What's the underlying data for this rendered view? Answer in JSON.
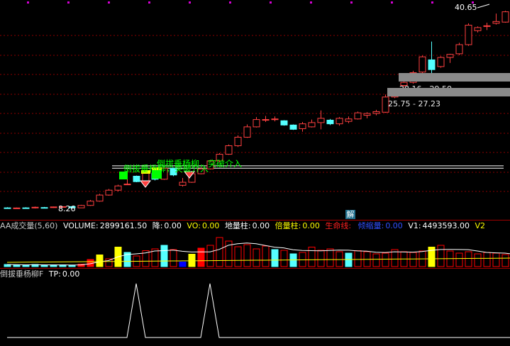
{
  "chart_data": [
    {
      "type": "candlestick",
      "panel": "price",
      "max_label": "40.65",
      "min_label": "8.26",
      "bands": [
        {
          "label": "28.16 - 29.50",
          "low": 28.16,
          "high": 29.5
        },
        {
          "label": "25.75 - 27.23",
          "low": 25.75,
          "high": 27.23
        }
      ],
      "signals": [
        {
          "text": "倒拔垂杨柳，突破介入",
          "color": "#00ff00"
        },
        {
          "text": "倒拔垂杨柳，突破介入",
          "color": "#00ff00"
        }
      ],
      "resistance_lines": [
        15.2,
        14.8
      ],
      "candles": [
        {
          "o": 8.3,
          "h": 8.4,
          "l": 8.2,
          "c": 8.3,
          "up": false
        },
        {
          "o": 8.25,
          "h": 8.35,
          "l": 8.15,
          "c": 8.28,
          "up": true
        },
        {
          "o": 8.3,
          "h": 8.4,
          "l": 8.2,
          "c": 8.3,
          "up": false
        },
        {
          "o": 8.3,
          "h": 8.5,
          "l": 8.2,
          "c": 8.4,
          "up": true
        },
        {
          "o": 8.35,
          "h": 8.45,
          "l": 8.25,
          "c": 8.35,
          "up": false
        },
        {
          "o": 8.4,
          "h": 8.5,
          "l": 8.3,
          "c": 8.45,
          "up": true
        },
        {
          "o": 8.45,
          "h": 8.55,
          "l": 8.4,
          "c": 8.5,
          "up": true
        },
        {
          "o": 8.5,
          "h": 8.6,
          "l": 8.2,
          "c": 8.3,
          "up": false
        },
        {
          "o": 8.3,
          "h": 8.8,
          "l": 8.26,
          "c": 8.7,
          "up": true
        },
        {
          "o": 8.7,
          "h": 9.6,
          "l": 8.6,
          "c": 9.4,
          "up": true
        },
        {
          "o": 9.4,
          "h": 10.6,
          "l": 9.3,
          "c": 10.4,
          "up": true
        },
        {
          "o": 10.4,
          "h": 11.4,
          "l": 10.3,
          "c": 11.2,
          "up": true
        },
        {
          "o": 11.2,
          "h": 12.1,
          "l": 11.0,
          "c": 11.9,
          "up": true
        },
        {
          "o": 12.2,
          "h": 14.8,
          "l": 12.1,
          "c": 12.2,
          "up": true
        },
        {
          "o": 13.5,
          "h": 13.6,
          "l": 12.5,
          "c": 12.6,
          "up": false
        },
        {
          "o": 12.6,
          "h": 14.5,
          "l": 12.3,
          "c": 14.0,
          "up": true
        },
        {
          "o": 14.0,
          "h": 14.2,
          "l": 12.8,
          "c": 13.0,
          "up": false
        },
        {
          "o": 13.0,
          "h": 14.9,
          "l": 12.9,
          "c": 14.8,
          "up": true
        },
        {
          "o": 14.8,
          "h": 14.9,
          "l": 13.5,
          "c": 13.7,
          "up": false
        },
        {
          "o": 12.5,
          "h": 13.2,
          "l": 11.8,
          "c": 12.0,
          "up": true
        },
        {
          "o": 12.5,
          "h": 14.1,
          "l": 12.4,
          "c": 13.9,
          "up": true
        },
        {
          "o": 13.9,
          "h": 15.0,
          "l": 13.8,
          "c": 14.7,
          "up": true
        },
        {
          "o": 14.7,
          "h": 16.2,
          "l": 14.6,
          "c": 16.0,
          "up": true
        },
        {
          "o": 16.0,
          "h": 17.3,
          "l": 15.8,
          "c": 17.1,
          "up": true
        },
        {
          "o": 17.1,
          "h": 18.7,
          "l": 17.0,
          "c": 18.5,
          "up": true
        },
        {
          "o": 18.5,
          "h": 20.2,
          "l": 18.3,
          "c": 19.9,
          "up": true
        },
        {
          "o": 19.9,
          "h": 22.0,
          "l": 19.8,
          "c": 21.6,
          "up": true
        },
        {
          "o": 21.6,
          "h": 23.2,
          "l": 21.5,
          "c": 22.8,
          "up": true
        },
        {
          "o": 22.7,
          "h": 23.4,
          "l": 22.4,
          "c": 22.8,
          "up": true
        },
        {
          "o": 22.8,
          "h": 23.3,
          "l": 22.5,
          "c": 22.9,
          "up": true
        },
        {
          "o": 22.6,
          "h": 22.7,
          "l": 21.8,
          "c": 21.9,
          "up": false
        },
        {
          "o": 21.9,
          "h": 22.0,
          "l": 21.1,
          "c": 21.2,
          "up": false
        },
        {
          "o": 21.3,
          "h": 22.4,
          "l": 20.8,
          "c": 22.1,
          "up": true
        },
        {
          "o": 21.6,
          "h": 22.8,
          "l": 21.5,
          "c": 22.3,
          "up": true
        },
        {
          "o": 22.3,
          "h": 24.3,
          "l": 21.2,
          "c": 23.0,
          "up": true
        },
        {
          "o": 22.7,
          "h": 22.9,
          "l": 21.9,
          "c": 22.1,
          "up": false
        },
        {
          "o": 22.1,
          "h": 23.2,
          "l": 21.8,
          "c": 23.0,
          "up": true
        },
        {
          "o": 22.5,
          "h": 23.3,
          "l": 22.2,
          "c": 22.9,
          "up": true
        },
        {
          "o": 22.9,
          "h": 24.1,
          "l": 22.8,
          "c": 23.9,
          "up": true
        },
        {
          "o": 23.5,
          "h": 24.0,
          "l": 23.0,
          "c": 23.8,
          "up": true
        },
        {
          "o": 23.8,
          "h": 24.4,
          "l": 23.5,
          "c": 24.1,
          "up": true
        },
        {
          "o": 24.0,
          "h": 26.9,
          "l": 23.9,
          "c": 26.5,
          "up": true
        },
        {
          "o": 26.5,
          "h": 27.6,
          "l": 26.3,
          "c": 27.2,
          "up": true
        },
        {
          "o": 28.4,
          "h": 29.2,
          "l": 28.1,
          "c": 28.9,
          "up": true
        },
        {
          "o": 28.9,
          "h": 30.8,
          "l": 28.7,
          "c": 30.5,
          "up": true
        },
        {
          "o": 30.6,
          "h": 33.3,
          "l": 30.4,
          "c": 33.1,
          "up": true
        },
        {
          "o": 32.6,
          "h": 35.6,
          "l": 30.4,
          "c": 31.0,
          "up": false
        },
        {
          "o": 31.5,
          "h": 33.2,
          "l": 31.3,
          "c": 33.0,
          "up": true
        },
        {
          "o": 33.0,
          "h": 33.6,
          "l": 32.1,
          "c": 33.5,
          "up": true
        },
        {
          "o": 33.6,
          "h": 35.4,
          "l": 33.4,
          "c": 35.1,
          "up": true
        },
        {
          "o": 35.1,
          "h": 38.6,
          "l": 34.9,
          "c": 38.3,
          "up": true
        },
        {
          "o": 37.4,
          "h": 38.1,
          "l": 37.1,
          "c": 37.9,
          "up": true
        },
        {
          "o": 38.1,
          "h": 38.7,
          "l": 37.5,
          "c": 38.2,
          "up": true
        },
        {
          "o": 38.6,
          "h": 40.2,
          "l": 38.4,
          "c": 38.9,
          "up": true
        },
        {
          "o": 38.8,
          "h": 40.65,
          "l": 38.7,
          "c": 40.5,
          "up": true
        },
        {
          "o": 39.5,
          "h": 39.6,
          "l": 37.2,
          "c": 37.5,
          "up": false
        }
      ]
    },
    {
      "type": "bar",
      "panel": "volume",
      "hud": {
        "title": "AA成交量(5,60)",
        "volume_label": "VOLUME:",
        "volume_value": "2899161.50",
        "jiang_label": "降:",
        "jiang_value": "0.00",
        "vo_label": "VO:",
        "vo_value": "0.00",
        "dlz_label": "地量柱:",
        "dlz_value": "0.00",
        "blz_label": "倍量柱:",
        "blz_value": "0.00",
        "smx_label": "生命线:",
        "smx_value": "",
        "qjl_label": "倾缩量:",
        "qjl_value": "0.00",
        "v1_label": "V1:",
        "v1_value": "4493593.00",
        "v2_label": "V2"
      },
      "values": [
        0.06,
        0.05,
        0.04,
        0.06,
        0.04,
        0.05,
        0.05,
        0.03,
        0.07,
        0.2,
        0.33,
        0.22,
        0.55,
        0.4,
        0.3,
        0.45,
        0.5,
        0.6,
        0.48,
        0.13,
        0.35,
        0.52,
        0.6,
        0.82,
        0.72,
        0.56,
        0.62,
        0.5,
        0.58,
        0.48,
        0.46,
        0.36,
        0.4,
        0.55,
        0.46,
        0.5,
        0.42,
        0.38,
        0.45,
        0.42,
        0.36,
        0.38,
        0.48,
        0.42,
        0.4,
        0.44,
        0.55,
        0.6,
        0.44,
        0.38,
        0.42,
        0.36,
        0.4,
        0.38,
        0.34,
        0.26
      ],
      "colors": [
        "#5ff",
        "#5ff",
        "#5ff",
        "#5ff",
        "#5ff",
        "#5ff",
        "#5ff",
        "#5ff",
        "#f00",
        "#f00",
        "#ff0",
        "#f00",
        "#ff0",
        "#5ff",
        "#f00",
        "#f00",
        "#f00",
        "#5ff",
        "#f00",
        "#00f",
        "#ff0",
        "#f00",
        "#f00",
        "#f00",
        "#f00",
        "#f00",
        "#f00",
        "#f00",
        "#f00",
        "#5ff",
        "#f00",
        "#5ff",
        "#f00",
        "#f00",
        "#f00",
        "#f00",
        "#f00",
        "#5ff",
        "#f00",
        "#f00",
        "#f00",
        "#f00",
        "#f00",
        "#f00",
        "#f00",
        "#f00",
        "#ff0",
        "#f00",
        "#f00",
        "#f00",
        "#f00",
        "#f00",
        "#f00",
        "#f00",
        "#f00",
        "#5ff"
      ],
      "filled": [
        true,
        true,
        true,
        true,
        true,
        true,
        true,
        true,
        true,
        true,
        true,
        false,
        true,
        true,
        false,
        false,
        false,
        true,
        false,
        true,
        true,
        true,
        false,
        false,
        false,
        false,
        false,
        false,
        false,
        true,
        false,
        true,
        false,
        false,
        false,
        false,
        false,
        true,
        false,
        false,
        false,
        false,
        false,
        false,
        false,
        false,
        true,
        false,
        false,
        false,
        false,
        false,
        false,
        false,
        false,
        true
      ]
    },
    {
      "type": "line",
      "panel": "signal",
      "hud": {
        "title": "倒拔垂杨柳F",
        "tp_label": "TP:",
        "tp_value": "0.00"
      },
      "values": [
        0,
        0,
        0,
        0,
        0,
        0,
        0,
        0,
        0,
        0,
        0,
        0,
        0,
        0,
        1,
        0,
        0,
        0,
        0,
        0,
        0,
        0,
        1,
        0,
        0,
        0,
        0,
        0,
        0,
        0,
        0,
        0,
        0,
        0,
        0,
        0,
        0,
        0,
        0,
        0,
        0,
        0,
        0,
        0,
        0,
        0,
        0,
        0,
        0,
        0,
        0,
        0,
        0,
        0,
        0,
        0
      ]
    }
  ],
  "colors": {
    "up": "#ff4040",
    "down": "#54ffff",
    "grid": "#8b0000",
    "ma": "#ffffff",
    "ma2": "#ffff00",
    "signal": "#ffffff"
  },
  "icons": {
    "solve": "解"
  }
}
